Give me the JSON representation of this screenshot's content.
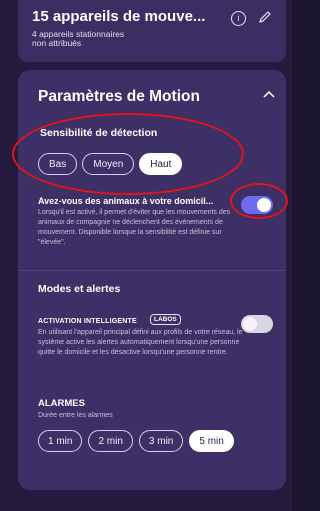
{
  "device": {
    "title": "15 appareils de mouve...",
    "subtitle_line1": "4 appareils stationnaires",
    "subtitle_line2": "non attribués",
    "info_glyph": "i"
  },
  "motion": {
    "section_title": "Paramètres de Motion",
    "sensitivity_label": "Sensibilité de détection",
    "sensitivity_options": [
      "Bas",
      "Moyen",
      "Haut"
    ],
    "sensitivity_selected": "Haut",
    "pets_title": "Avez-vous des animaux à votre domicil...",
    "pets_description": "Lorsqu'il est activé, il permet d'éviter que les mouvements des animaux de compagnie ne déclenchent des événements de mouvement. Disponible lorsque la sensibilité est définie sur \"élevée\".",
    "pets_toggle_on": true
  },
  "modes": {
    "title": "Modes et alertes",
    "ai_title": "ACTIVATION INTELLIGENTE",
    "ai_badge": "LABOS",
    "ai_description": "En utilisant l'appareil principal défini aux profils de votre réseau, le système active les alertes automatiquement lorsqu'une personne quitte le domicile et les désactive lorsqu'une personne rentre.",
    "ai_toggle_on": false
  },
  "alarms": {
    "title": "ALARMES",
    "subtitle": "Durée entre les alarmes",
    "options": [
      "1 min",
      "2 min",
      "3 min",
      "5 min"
    ],
    "selected": "5 min"
  },
  "colors": {
    "background": "#241b3f",
    "card": "#3d3066",
    "toggle_on": "#6f6cf0",
    "annotation_red": "#e0151b"
  }
}
